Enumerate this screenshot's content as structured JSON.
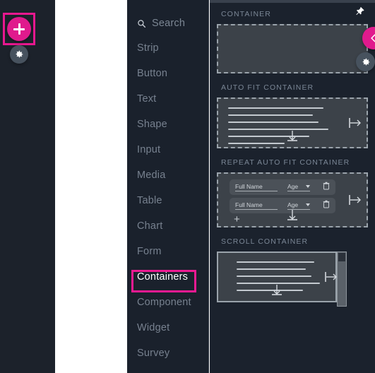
{
  "toolbar": {
    "add_button_label": "+",
    "add_button_icon": "plus-icon",
    "gear_icon": "gear-icon",
    "accent_color": "#e01a8d",
    "highlight_color": "#ed1a92"
  },
  "sidebar": {
    "search": {
      "label": "Search",
      "icon": "search-icon"
    },
    "items": [
      {
        "label": "Strip",
        "active": false
      },
      {
        "label": "Button",
        "active": false
      },
      {
        "label": "Text",
        "active": false
      },
      {
        "label": "Shape",
        "active": false
      },
      {
        "label": "Input",
        "active": false
      },
      {
        "label": "Media",
        "active": false
      },
      {
        "label": "Table",
        "active": false
      },
      {
        "label": "Chart",
        "active": false
      },
      {
        "label": "Form",
        "active": false
      },
      {
        "label": "Containers",
        "active": true
      },
      {
        "label": "Component",
        "active": false
      },
      {
        "label": "Widget",
        "active": false
      },
      {
        "label": "Survey",
        "active": false
      }
    ]
  },
  "panel": {
    "sections": [
      {
        "title": "CONTAINER",
        "type": "plain"
      },
      {
        "title": "AUTO FIT CONTAINER",
        "type": "autofit"
      },
      {
        "title": "REPEAT AUTO FIT CONTAINER",
        "type": "repeat"
      },
      {
        "title": "SCROLL CONTAINER",
        "type": "scroll"
      }
    ],
    "repeat_rows": [
      {
        "name_placeholder": "Full Name",
        "age_label": "Age"
      },
      {
        "name_placeholder": "Full Name",
        "age_label": "Age"
      }
    ],
    "repeat_add_label": "+",
    "trash_icon": "trash-icon",
    "fit_horizontal_icon": "fit-horizontal-arrow-icon",
    "fit_vertical_icon": "fit-vertical-arrow-icon",
    "scrollbar_up_icon": "scroll-up-arrow-icon"
  },
  "overlay": {
    "pin_icon": "pushpin-icon",
    "collapse_icon": "chevron-left-icon",
    "settings_icon": "gear-icon"
  }
}
